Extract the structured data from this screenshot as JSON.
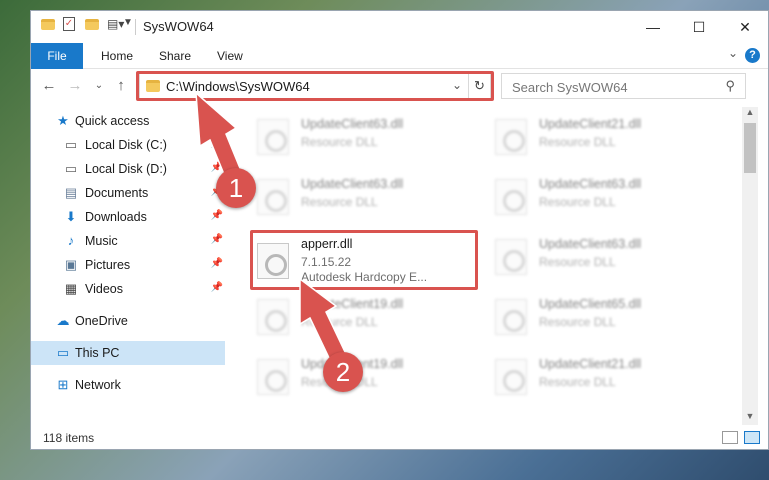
{
  "window": {
    "title": "SysWOW64",
    "minimize": "—",
    "maximize": "☐",
    "close": "✕"
  },
  "ribbon": {
    "file": "File",
    "home": "Home",
    "share": "Share",
    "view": "View",
    "help": "?"
  },
  "address": {
    "path": "C:\\Windows\\SysWOW64",
    "search_placeholder": "Search SysWOW64"
  },
  "sidebar": {
    "items": [
      {
        "label": "Quick access",
        "icon": "star-icon"
      },
      {
        "label": "Local Disk (C:)",
        "icon": "drive-icon"
      },
      {
        "label": "Local Disk (D:)",
        "icon": "drive-icon"
      },
      {
        "label": "Documents",
        "icon": "documents-icon"
      },
      {
        "label": "Downloads",
        "icon": "download-icon"
      },
      {
        "label": "Music",
        "icon": "music-icon"
      },
      {
        "label": "Pictures",
        "icon": "pictures-icon"
      },
      {
        "label": "Videos",
        "icon": "videos-icon"
      },
      {
        "label": "OneDrive",
        "icon": "cloud-icon"
      },
      {
        "label": "This PC",
        "icon": "computer-icon"
      },
      {
        "label": "Network",
        "icon": "network-icon"
      }
    ]
  },
  "files": {
    "left": [
      {
        "name": "UpdateClient63.dll",
        "desc": "Resource DLL"
      },
      {
        "name": "UpdateClient63.dll",
        "desc": "Resource DLL"
      },
      {
        "name": "apperr.dll",
        "version": "7.1.15.22",
        "desc": "Autodesk Hardcopy E..."
      },
      {
        "name": "UpdateClient19.dll",
        "desc": "Resource DLL"
      },
      {
        "name": "UpdateClient19.dll",
        "desc": "Resource DLL"
      }
    ],
    "right": [
      {
        "name": "UpdateClient21.dll",
        "desc": "Resource DLL"
      },
      {
        "name": "UpdateClient63.dll",
        "desc": "Resource DLL"
      },
      {
        "name": "UpdateClient63.dll",
        "desc": "Resource DLL"
      },
      {
        "name": "UpdateClient65.dll",
        "desc": "Resource DLL"
      },
      {
        "name": "UpdateClient21.dll",
        "desc": "Resource DLL"
      }
    ]
  },
  "status": {
    "item_count": "118 items"
  },
  "annotations": {
    "step1": "1",
    "step2": "2"
  },
  "colors": {
    "accent": "#1979ca",
    "highlight": "#d9534f",
    "selected": "#cce4f7"
  }
}
